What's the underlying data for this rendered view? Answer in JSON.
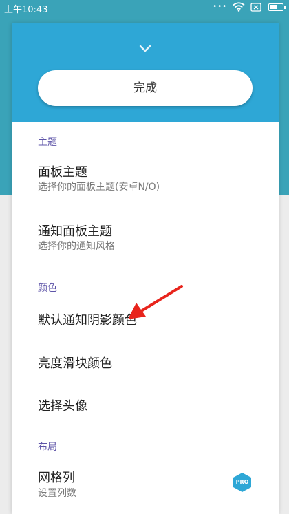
{
  "status_bar": {
    "time": "上午10:43",
    "dots": "•••"
  },
  "header": {
    "done_label": "完成"
  },
  "sections": [
    {
      "title": "主题",
      "items": [
        {
          "title": "面板主题",
          "subtitle": "选择你的面板主题(安卓N/O)"
        },
        {
          "title": "通知面板主题",
          "subtitle": "选择你的通知风格"
        }
      ]
    },
    {
      "title": "颜色",
      "items": [
        {
          "title": "默认通知阴影颜色"
        },
        {
          "title": "亮度滑块颜色"
        },
        {
          "title": "选择头像"
        }
      ]
    },
    {
      "title": "布局",
      "items": [
        {
          "title": "网格列",
          "subtitle": "设置列数",
          "badge": "PRO"
        }
      ]
    }
  ],
  "colors": {
    "accent": "#2ea7d6",
    "section_title": "#5e54a8",
    "annotation_arrow": "#e8241c"
  }
}
